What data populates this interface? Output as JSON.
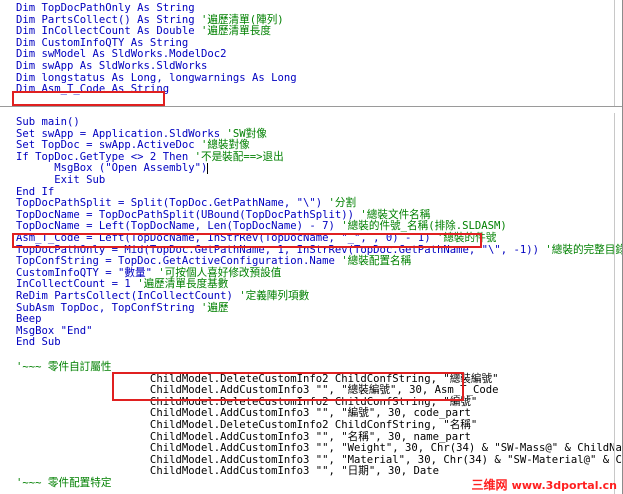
{
  "pane1": [
    [
      {
        "t": "Dim TopDocPathOnly As String",
        "c": "blue"
      }
    ],
    [
      {
        "t": "Dim PartsCollect() As String ",
        "c": "blue"
      },
      {
        "t": "'遍歷清單(陣列)",
        "c": "green"
      }
    ],
    [
      {
        "t": "Dim InCollectCount As Double ",
        "c": "blue"
      },
      {
        "t": "'遍歷清單長度",
        "c": "green"
      }
    ],
    [
      {
        "t": "Dim CustomInfoQTY As String",
        "c": "blue"
      }
    ],
    [
      {
        "t": "Dim swModel As SldWorks.ModelDoc2",
        "c": "blue"
      }
    ],
    [
      {
        "t": "Dim swApp As SldWorks.SldWorks",
        "c": "blue"
      }
    ],
    [
      {
        "t": "Dim longstatus As Long, longwarnings As Long",
        "c": "blue"
      }
    ],
    [
      {
        "t": "Dim Asm_T_Code As String",
        "c": "blue"
      }
    ]
  ],
  "pane2": [
    [
      {
        "t": "Sub main()",
        "c": "blue"
      }
    ],
    [
      {
        "t": "Set swApp = Application.SldWorks ",
        "c": "blue"
      },
      {
        "t": "'SW對像",
        "c": "green"
      }
    ],
    [
      {
        "t": "Set TopDoc = swApp.ActiveDoc ",
        "c": "blue"
      },
      {
        "t": "'總裝對像",
        "c": "green"
      }
    ],
    [
      {
        "t": "If TopDoc.GetType <> 2 Then ",
        "c": "blue"
      },
      {
        "t": "'不是裝配==>退出",
        "c": "green"
      }
    ],
    [
      {
        "t": "      MsgBox (\"Open Assembly\")",
        "c": "blue"
      },
      {
        "t": "|",
        "c": "caret"
      }
    ],
    [
      {
        "t": "      Exit Sub",
        "c": "blue"
      }
    ],
    [
      {
        "t": "End If",
        "c": "blue"
      }
    ],
    [
      {
        "t": "TopDocPathSplit = Split(TopDoc.GetPathName, \"\\\") ",
        "c": "blue"
      },
      {
        "t": "'分割",
        "c": "green"
      }
    ],
    [
      {
        "t": "TopDocName = TopDocPathSplit(UBound(TopDocPathSplit)) ",
        "c": "blue"
      },
      {
        "t": "'總裝文件名稱",
        "c": "green"
      }
    ],
    [
      {
        "t": "TopDocName = Left(TopDocName, Len(TopDocName) - 7) ",
        "c": "blue"
      },
      {
        "t": "'總裝的件號_名稱(排除.SLDASM)",
        "c": "green"
      }
    ],
    [
      {
        "t": "Asm_T_Code = Left(TopDocName, InStrRev(TopDocName, \"_\", , 0) - 1) ",
        "c": "blue"
      },
      {
        "t": "'總裝的件號",
        "c": "green"
      }
    ],
    [
      {
        "t": "TopDocPathOnly = Mid(TopDoc.GetPathName, 1, InStrRev(TopDoc.GetPathName, \"\\\", -1)) ",
        "c": "blue"
      },
      {
        "t": "'總裝的完整目錄",
        "c": "green"
      }
    ],
    [
      {
        "t": "TopConfString = TopDoc.GetActiveConfiguration.Name ",
        "c": "blue"
      },
      {
        "t": "'總裝配置名稱",
        "c": "green"
      }
    ],
    [
      {
        "t": "CustomInfoQTY = \"數量\" ",
        "c": "blue"
      },
      {
        "t": "'可按個人喜好修改預設值",
        "c": "green"
      }
    ],
    [
      {
        "t": "InCollectCount = 1 ",
        "c": "blue"
      },
      {
        "t": "'遍歷清單長度基數",
        "c": "green"
      }
    ],
    [
      {
        "t": "ReDim PartsCollect(InCollectCount) ",
        "c": "blue"
      },
      {
        "t": "'定義陣列項數",
        "c": "green"
      }
    ],
    [
      {
        "t": "SubAsm TopDoc, TopConfString ",
        "c": "blue"
      },
      {
        "t": "'遍歷",
        "c": "green"
      }
    ],
    [
      {
        "t": "Beep",
        "c": "blue"
      }
    ],
    [
      {
        "t": "MsgBox \"End\"",
        "c": "blue"
      }
    ],
    [
      {
        "t": "End Sub",
        "c": "blue"
      }
    ]
  ],
  "pane3": [
    [
      {
        "t": "'~~~ 零件自訂屬性",
        "c": "green"
      }
    ],
    [
      {
        "t": "                     ChildModel.DeleteCustomInfo2 ChildConfString, \"總裝編號\"",
        "c": "black"
      }
    ],
    [
      {
        "t": "                     ChildModel.AddCustomInfo3 \"\", \"總裝編號\", 30, Asm_T_Code",
        "c": "black"
      }
    ],
    [
      {
        "t": "                     ChildModel.DeleteCustomInfo2 ChildConfString, \"編號\"",
        "c": "black"
      }
    ],
    [
      {
        "t": "                     ChildModel.AddCustomInfo3 \"\", \"編號\", 30, code_part",
        "c": "black"
      }
    ],
    [
      {
        "t": "                     ChildModel.DeleteCustomInfo2 ChildConfString, \"名稱\"",
        "c": "black"
      }
    ],
    [
      {
        "t": "                     ChildModel.AddCustomInfo3 \"\", \"名稱\", 30, name_part",
        "c": "black"
      }
    ],
    [
      {
        "t": "                     ChildModel.AddCustomInfo3 \"\", \"Weight\", 30, Chr(34) & \"SW-Mass@\" & ChildName & Chr(34)",
        "c": "black"
      }
    ],
    [
      {
        "t": "                     ChildModel.AddCustomInfo3 \"\", \"Material\", 30, Chr(34) & \"SW-Material@\" & ChildName & Chr(34)",
        "c": "black"
      }
    ],
    [
      {
        "t": "                     ChildModel.AddCustomInfo3 \"\", \"日期\", 30, Date",
        "c": "black"
      }
    ],
    [
      {
        "t": "'~~~ 零件配置特定",
        "c": "green"
      }
    ]
  ],
  "watermark": {
    "cn": "三维网",
    "url": "www.3dportal.cn"
  },
  "colors": {
    "keyword": "#0000c0",
    "comment": "#008000",
    "highlight_box": "#e02020",
    "watermark": "#ff2020"
  }
}
